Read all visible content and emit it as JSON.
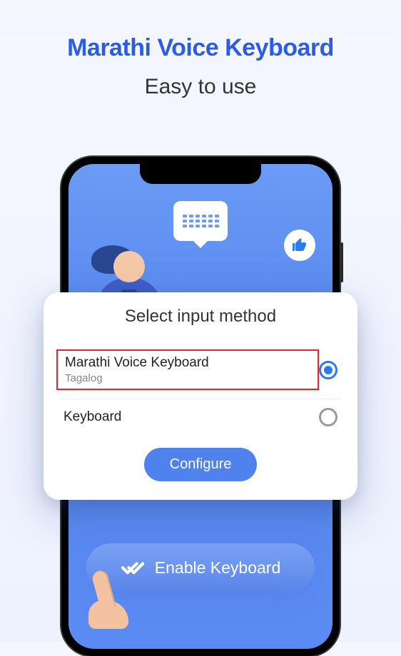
{
  "heading": {
    "title": "Marathi Voice Keyboard",
    "subtitle": "Easy to use"
  },
  "modal": {
    "title": "Select input method",
    "options": [
      {
        "label": "Marathi Voice Keyboard",
        "sub": "Tagalog",
        "selected": true,
        "highlighted": true
      },
      {
        "label": "Keyboard",
        "sub": "",
        "selected": false,
        "highlighted": false
      }
    ],
    "configure_label": "Configure"
  },
  "enable_button": {
    "label": "Enable Keyboard"
  },
  "icons": {
    "keyboard": "keyboard-icon",
    "thumbs_up": "thumbs-up-icon",
    "double_check": "double-check-icon"
  }
}
